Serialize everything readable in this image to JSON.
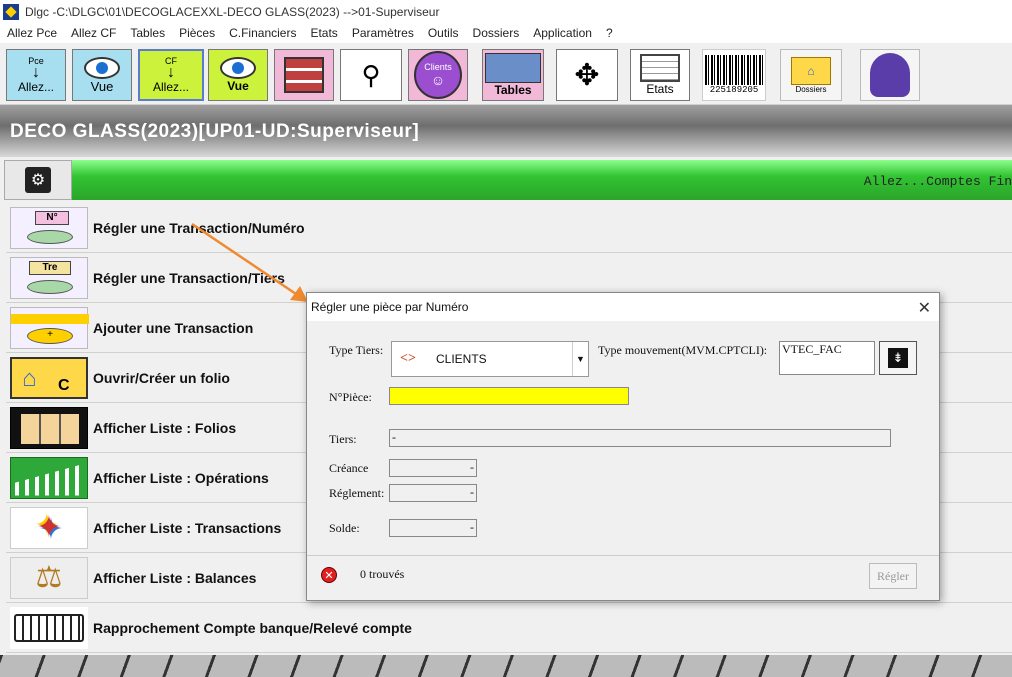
{
  "window": {
    "title": "Dlgc -C:\\DLGC\\01\\DECOGLACEXXL-DECO GLASS(2023) -->01-Superviseur"
  },
  "menu": [
    "Allez Pce",
    "Allez CF",
    "Tables",
    "Pièces",
    "C.Financiers",
    "Etats",
    "Paramètres",
    "Outils",
    "Dossiers",
    "Application",
    "?"
  ],
  "toolbar": {
    "pce_top": "Pce",
    "pce_label": "Allez...",
    "vue1_label": "Vue",
    "cf_top": "CF",
    "cf_label": "Allez...",
    "vue2_label": "Vue",
    "clients_label": "Clients",
    "tables_label": "Tables",
    "etats_label": "Etats",
    "barcode_digits": "225189205",
    "dossiers_label": "Dossiers"
  },
  "header": {
    "title": "DECO GLASS(2023)[UP01-UD:Superviseur]"
  },
  "green_bar": {
    "scroll_text": "Allez...Comptes Fin"
  },
  "actions": [
    {
      "label": "Régler une Transaction/Numéro",
      "icon_text": "N°"
    },
    {
      "label": "Régler une Transaction/Tiers",
      "icon_text": "Tre"
    },
    {
      "label": "Ajouter une Transaction"
    },
    {
      "label": "Ouvrir/Créer un folio",
      "icon_text": "C"
    },
    {
      "label": "Afficher Liste : Folios"
    },
    {
      "label": "Afficher Liste : Opérations"
    },
    {
      "label": "Afficher Liste : Transactions"
    },
    {
      "label": "Afficher Liste : Balances"
    },
    {
      "label": "Rapprochement Compte banque/Relevé compte"
    }
  ],
  "dialog": {
    "title": "Régler une pièce par Numéro",
    "type_tiers_label": "Type Tiers:",
    "type_tiers_value": "CLIENTS",
    "type_mvt_label": "Type mouvement(MVM.CPTCLI):",
    "type_mvt_value": "VTEC_FAC",
    "npiece_label": "N°Pièce:",
    "npiece_value": "",
    "tiers_label": "Tiers:",
    "tiers_value": "-",
    "creance_label": "Créance",
    "creance_value": "-",
    "reglement_label": "Réglement:",
    "reglement_value": "-",
    "solde_label": "Solde:",
    "solde_value": "-",
    "status_text": "0 trouvés",
    "regler_label": "Régler"
  }
}
